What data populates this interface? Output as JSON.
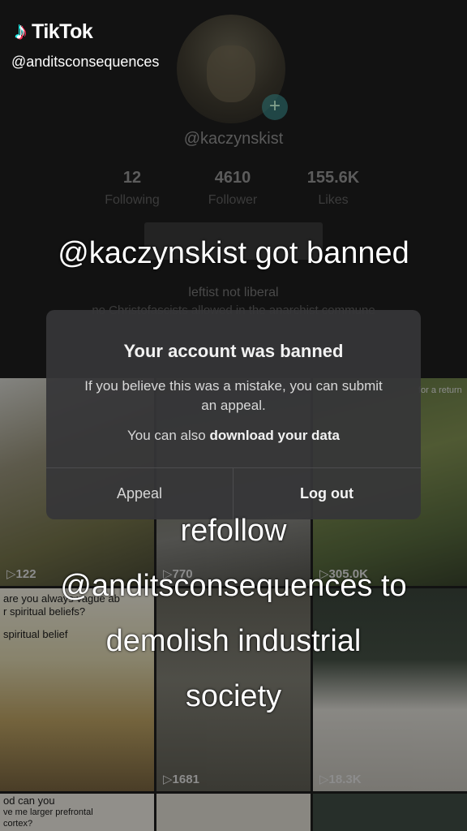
{
  "watermark": {
    "brand": "TikTok",
    "username": "@anditsconsequences"
  },
  "profile": {
    "handle": "@kaczynskist",
    "stats": [
      {
        "value": "12",
        "label": "Following"
      },
      {
        "value": "4610",
        "label": "Follower"
      },
      {
        "value": "155.6K",
        "label": "Likes"
      }
    ],
    "bio_line1": "leftist not liberal",
    "bio_line2": "no Christofascists allowed in the anarchist commune"
  },
  "grid_counts": [
    "122",
    "770",
    "305.0K",
    "1681",
    "18.3K"
  ],
  "grid_texts": {
    "t1": "are you always vague ab",
    "t2": "r spiritual beliefs?",
    "t3": "spiritual belief",
    "t4": "od can you",
    "t5": "ve me larger prefrontal cortex?",
    "t6": "for a return"
  },
  "captions": {
    "top": "@kaczynskist got banned",
    "bottom_lines": [
      "refollow",
      "@anditsconsequences to",
      "demolish industrial",
      "society"
    ]
  },
  "dialog": {
    "title": "Your account was banned",
    "message": "If you believe this was a mistake, you can submit an appeal.",
    "download_prefix": "You can also ",
    "download_link": "download your data",
    "appeal_button": "Appeal",
    "logout_button": "Log out"
  },
  "colors": {
    "tiktok_cyan": "#25f4ee",
    "tiktok_red": "#fe2c55",
    "dialog_bg": "#363638"
  }
}
